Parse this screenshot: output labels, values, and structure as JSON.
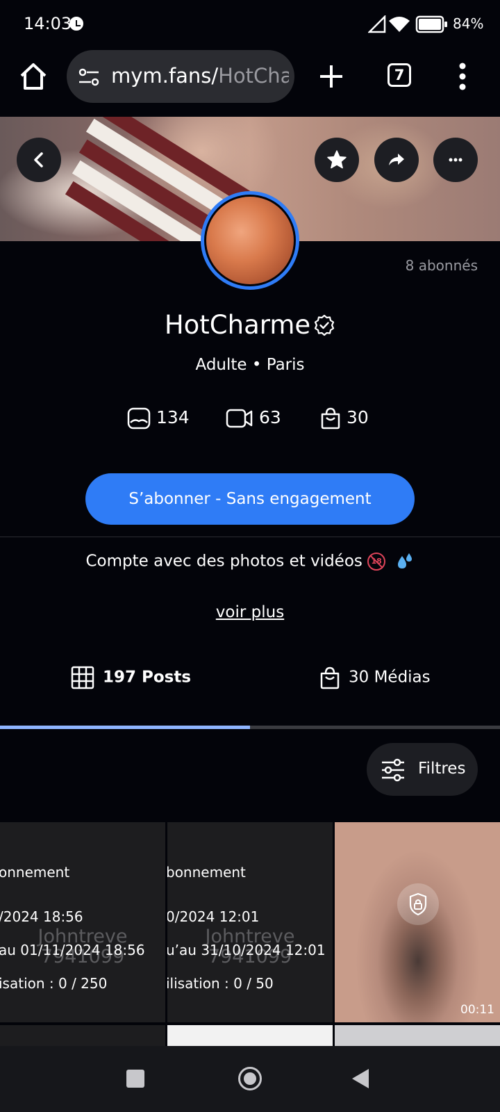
{
  "status_bar": {
    "time": "14:03",
    "battery": "84%"
  },
  "browser": {
    "url_host": "mym.fans/",
    "url_path": "HotCharme",
    "tab_count": "7"
  },
  "profile": {
    "subscribers": "8 abonnés",
    "name": "HotCharme",
    "meta": "Adulte • Paris",
    "stats": {
      "photos": "134",
      "videos": "63",
      "medias": "30"
    },
    "subscribe_label": "S’abonner - Sans engagement",
    "bio": "Compte avec des photos et vidéos",
    "bio_emoji": "18",
    "see_more": "voir plus"
  },
  "tabs": {
    "posts": "197 Posts",
    "medias": "30 Médias"
  },
  "filters_label": "Filtres",
  "posts": [
    {
      "line1": "onnement",
      "line2": "/2024 18:56",
      "line3": "au 01/11/2024 18:56",
      "line4": "isation : 0 / 250",
      "watermark1": "Johntreve",
      "watermark2": "7941099"
    },
    {
      "line1": "bonnement",
      "line2": "0/2024 12:01",
      "line3": "u’au 31/10/2024 12:01",
      "line4": "ilisation : 0 / 50",
      "watermark1": "Johntreve",
      "watermark2": "7941099"
    },
    {
      "duration": "00:11"
    }
  ],
  "colors": {
    "accent": "#2f7cf6",
    "background": "#03040a",
    "tab_indicator": "#8fb5ff"
  }
}
